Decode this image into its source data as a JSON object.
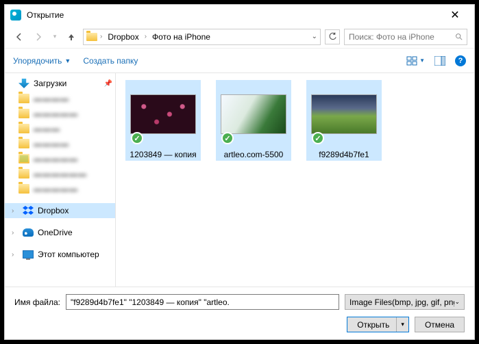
{
  "window": {
    "title": "Открытие"
  },
  "nav": {
    "breadcrumb": [
      "Dropbox",
      "Фото на iPhone"
    ],
    "search_placeholder": "Поиск: Фото на iPhone"
  },
  "toolbar": {
    "organize": "Упорядочить",
    "new_folder": "Создать папку"
  },
  "sidebar": {
    "downloads": "Загрузки",
    "blurred": [
      "▬▬▬▬",
      "▬▬▬▬▬",
      "▬▬▬",
      "▬▬▬▬",
      "▬▬▬▬▬",
      "▬▬▬▬▬▬",
      "▬▬▬▬▬"
    ],
    "dropbox": "Dropbox",
    "onedrive": "OneDrive",
    "this_pc": "Этот компьютер"
  },
  "files": [
    {
      "name": "1203849 — копия",
      "selected": true,
      "imgclass": "img-a"
    },
    {
      "name": "artleo.com-5500",
      "selected": true,
      "imgclass": "img-b"
    },
    {
      "name": "f9289d4b7fe1",
      "selected": true,
      "imgclass": "img-c"
    }
  ],
  "footer": {
    "filename_label": "Имя файла:",
    "filename_value": "\"f9289d4b7fe1\" \"1203849 — копия\" \"artleo.",
    "filter": "Image Files(bmp, jpg, gif, png,",
    "open": "Открыть",
    "cancel": "Отмена"
  }
}
